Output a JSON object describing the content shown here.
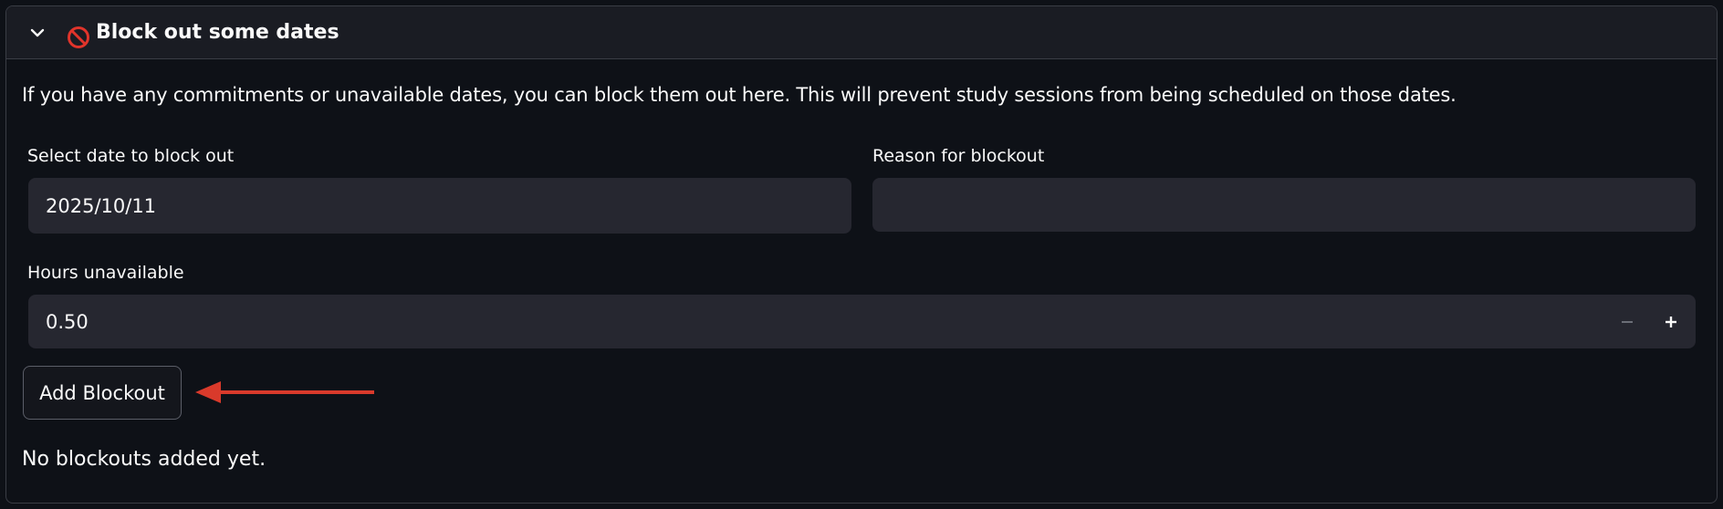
{
  "expander": {
    "icon": "no-entry-icon",
    "title": "Block out some dates",
    "expanded": true
  },
  "intro_text": "If you have any commitments or unavailable dates, you can block them out here. This will prevent study sessions from being scheduled on those dates.",
  "date_field": {
    "label": "Select date to block out",
    "value": "2025/10/11"
  },
  "reason_field": {
    "label": "Reason for blockout",
    "value": ""
  },
  "hours_field": {
    "label": "Hours unavailable",
    "value": "0.50",
    "decrement_icon": "minus-icon",
    "increment_icon": "plus-icon"
  },
  "add_button": {
    "label": "Add Blockout"
  },
  "annotation": {
    "icon": "arrow-left-icon",
    "color": "#d93a2b"
  },
  "empty_message": "No blockouts added yet.",
  "colors": {
    "background": "#0e1117",
    "header_background": "#1a1c23",
    "input_background": "#262730",
    "border": "#3a3d45",
    "text": "#fafafa"
  }
}
